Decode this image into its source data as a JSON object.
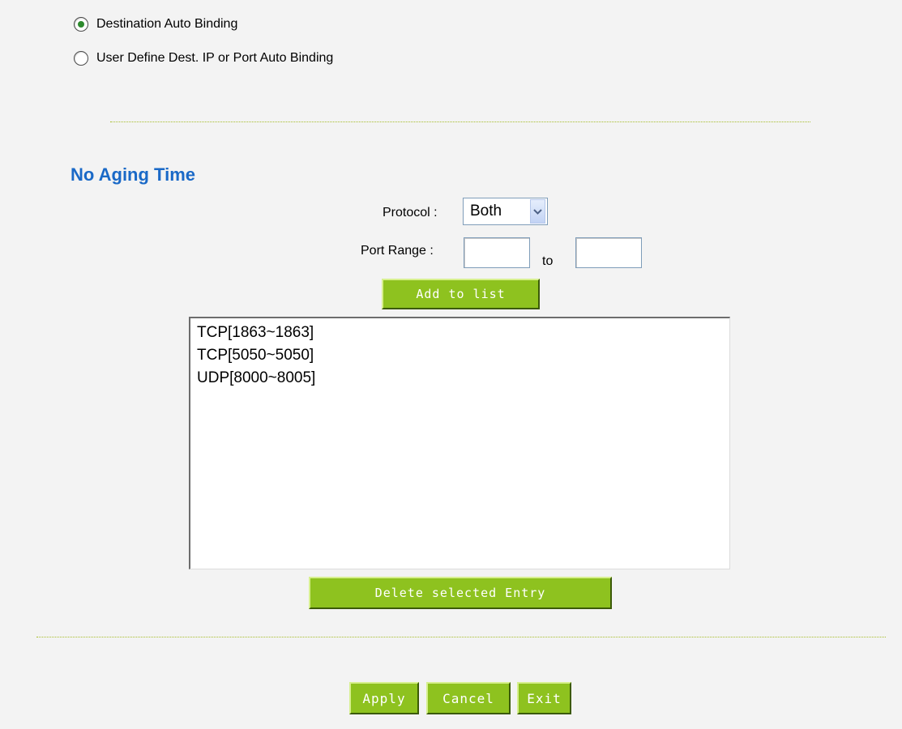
{
  "binding": {
    "options": [
      {
        "label": "Destination Auto Binding",
        "checked": true
      },
      {
        "label": "User Define Dest. IP or Port Auto Binding",
        "checked": false
      }
    ]
  },
  "no_aging": {
    "title": "No Aging Time",
    "protocol_label": "Protocol :",
    "protocol_value": "Both",
    "port_range_label": "Port Range :",
    "port_from": "",
    "to_label": "to",
    "port_to": "",
    "add_button": "Add to list",
    "list_items": [
      "TCP[1863~1863]",
      "TCP[5050~5050]",
      "UDP[8000~8005]"
    ],
    "delete_button": "Delete selected Entry"
  },
  "footer": {
    "apply": "Apply",
    "cancel": "Cancel",
    "exit": "Exit"
  },
  "colors": {
    "accent_green": "#8ec21f",
    "title_blue": "#1a69c7",
    "background": "#f3f3f3"
  },
  "icons": {
    "select_arrow": "chevron-down-icon"
  }
}
